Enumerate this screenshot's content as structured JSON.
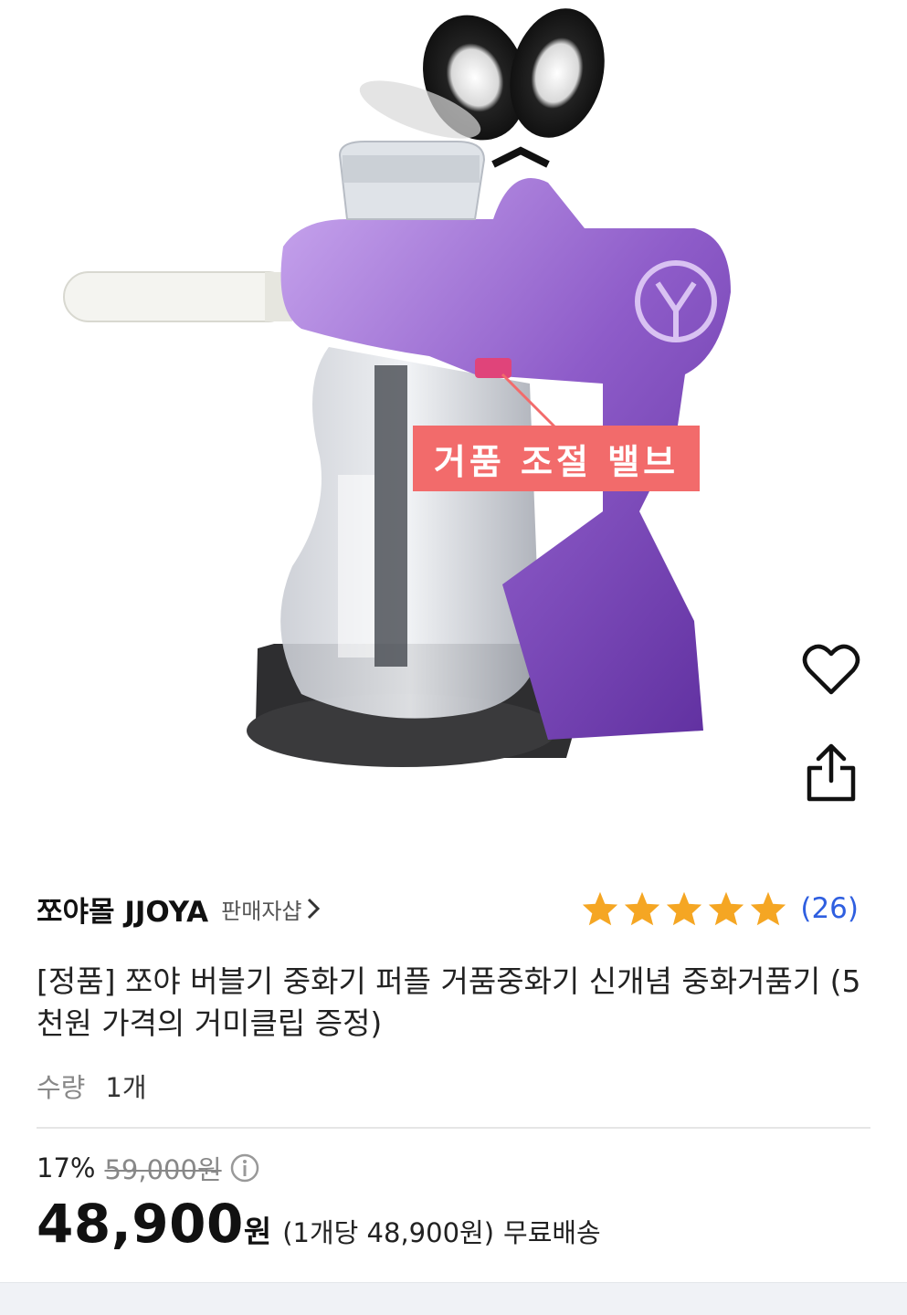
{
  "product_image": {
    "callout_label": "거품 조절 밸브"
  },
  "actions": {
    "like_icon": "heart-outline-icon",
    "share_icon": "share-icon"
  },
  "seller": {
    "name": "쪼야몰 JJOYA",
    "shop_link": "판매자샵"
  },
  "rating": {
    "stars": 5,
    "star_color": "#f5a623",
    "review_count": "(26)",
    "count_color": "#2f5fe0"
  },
  "product": {
    "title": "[정품] 쪼야 버블기 중화기 퍼플 거품중화기 신개념 중화거품기 (5천원 가격의 거미클립 증정)"
  },
  "quantity": {
    "label": "수량",
    "value": "1개"
  },
  "pricing": {
    "discount_rate": "17%",
    "original_price": "59,000원",
    "sale_price": "48,900",
    "currency": "원",
    "unit_price": "(1개당 48,900원)",
    "shipping": "무료배송"
  },
  "colors": {
    "callout_bg": "#f26b6b",
    "product_purple": "#9b6ad0"
  }
}
